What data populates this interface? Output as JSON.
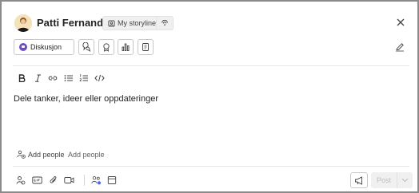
{
  "header": {
    "author_name": "Patti Fernandez",
    "storyline_label": "My storyline"
  },
  "type_selector": {
    "selected": "Diskusjon"
  },
  "editor": {
    "placeholder": "Dele tanker, ideer eller oppdateringer"
  },
  "recipients": {
    "add_people_label": "Add people",
    "add_people_input_placeholder": "Add people"
  },
  "actions": {
    "post_label": "Post"
  },
  "colors": {
    "discussion_accent": "#6b4fbb",
    "border": "#8a8a8a"
  }
}
